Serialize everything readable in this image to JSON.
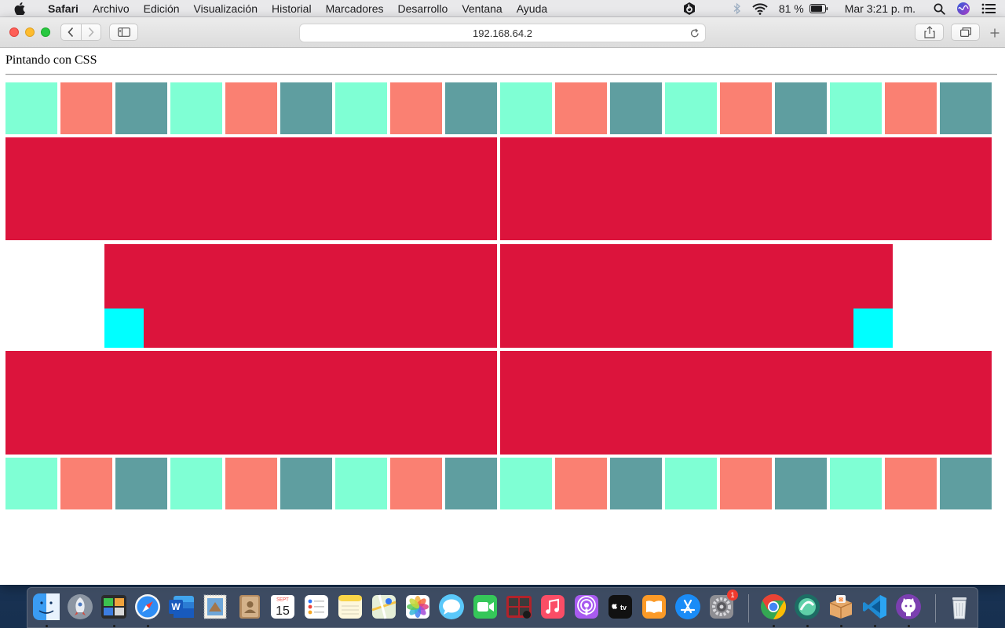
{
  "menubar": {
    "app_name": "Safari",
    "items": [
      "Archivo",
      "Edición",
      "Visualización",
      "Historial",
      "Marcadores",
      "Desarrollo",
      "Ventana",
      "Ayuda"
    ],
    "battery_percent": "81 %",
    "clock": "Mar 3:21 p. m."
  },
  "browser": {
    "address": "192.168.64.2"
  },
  "page": {
    "heading": "Pintando con CSS"
  },
  "colors": {
    "aquamarine": "#7fffd4",
    "salmon": "#fa8072",
    "cadetblue": "#5f9ea0",
    "crimson": "#dc143c",
    "cyan": "#00ffff"
  },
  "tile_pattern": [
    "aquamarine",
    "salmon",
    "cadetblue"
  ],
  "dock": {
    "calendar_month": "SEPT",
    "calendar_day": "15",
    "system_prefs_badge": "1",
    "tv_label": "tv",
    "apps": [
      {
        "name": "finder",
        "running": true
      },
      {
        "name": "launchpad",
        "running": false
      },
      {
        "name": "activity-monitor",
        "running": true
      },
      {
        "name": "safari",
        "running": true
      },
      {
        "name": "word",
        "running": false
      },
      {
        "name": "mail",
        "running": false
      },
      {
        "name": "contacts",
        "running": false
      },
      {
        "name": "calendar",
        "running": false
      },
      {
        "name": "reminders",
        "running": false
      },
      {
        "name": "notes",
        "running": false
      },
      {
        "name": "maps",
        "running": false
      },
      {
        "name": "photos",
        "running": false
      },
      {
        "name": "messages",
        "running": false
      },
      {
        "name": "facetime",
        "running": false
      },
      {
        "name": "photo-booth",
        "running": false
      },
      {
        "name": "music",
        "running": false
      },
      {
        "name": "podcasts",
        "running": false
      },
      {
        "name": "apple-tv",
        "running": false
      },
      {
        "name": "books",
        "running": false
      },
      {
        "name": "app-store",
        "running": false
      },
      {
        "name": "system-preferences",
        "running": false
      },
      {
        "name": "chrome",
        "running": true
      },
      {
        "name": "multipass",
        "running": true
      },
      {
        "name": "xampp",
        "running": true
      },
      {
        "name": "vscode",
        "running": true
      },
      {
        "name": "github-desktop",
        "running": true
      },
      {
        "name": "trash",
        "running": false
      }
    ]
  }
}
